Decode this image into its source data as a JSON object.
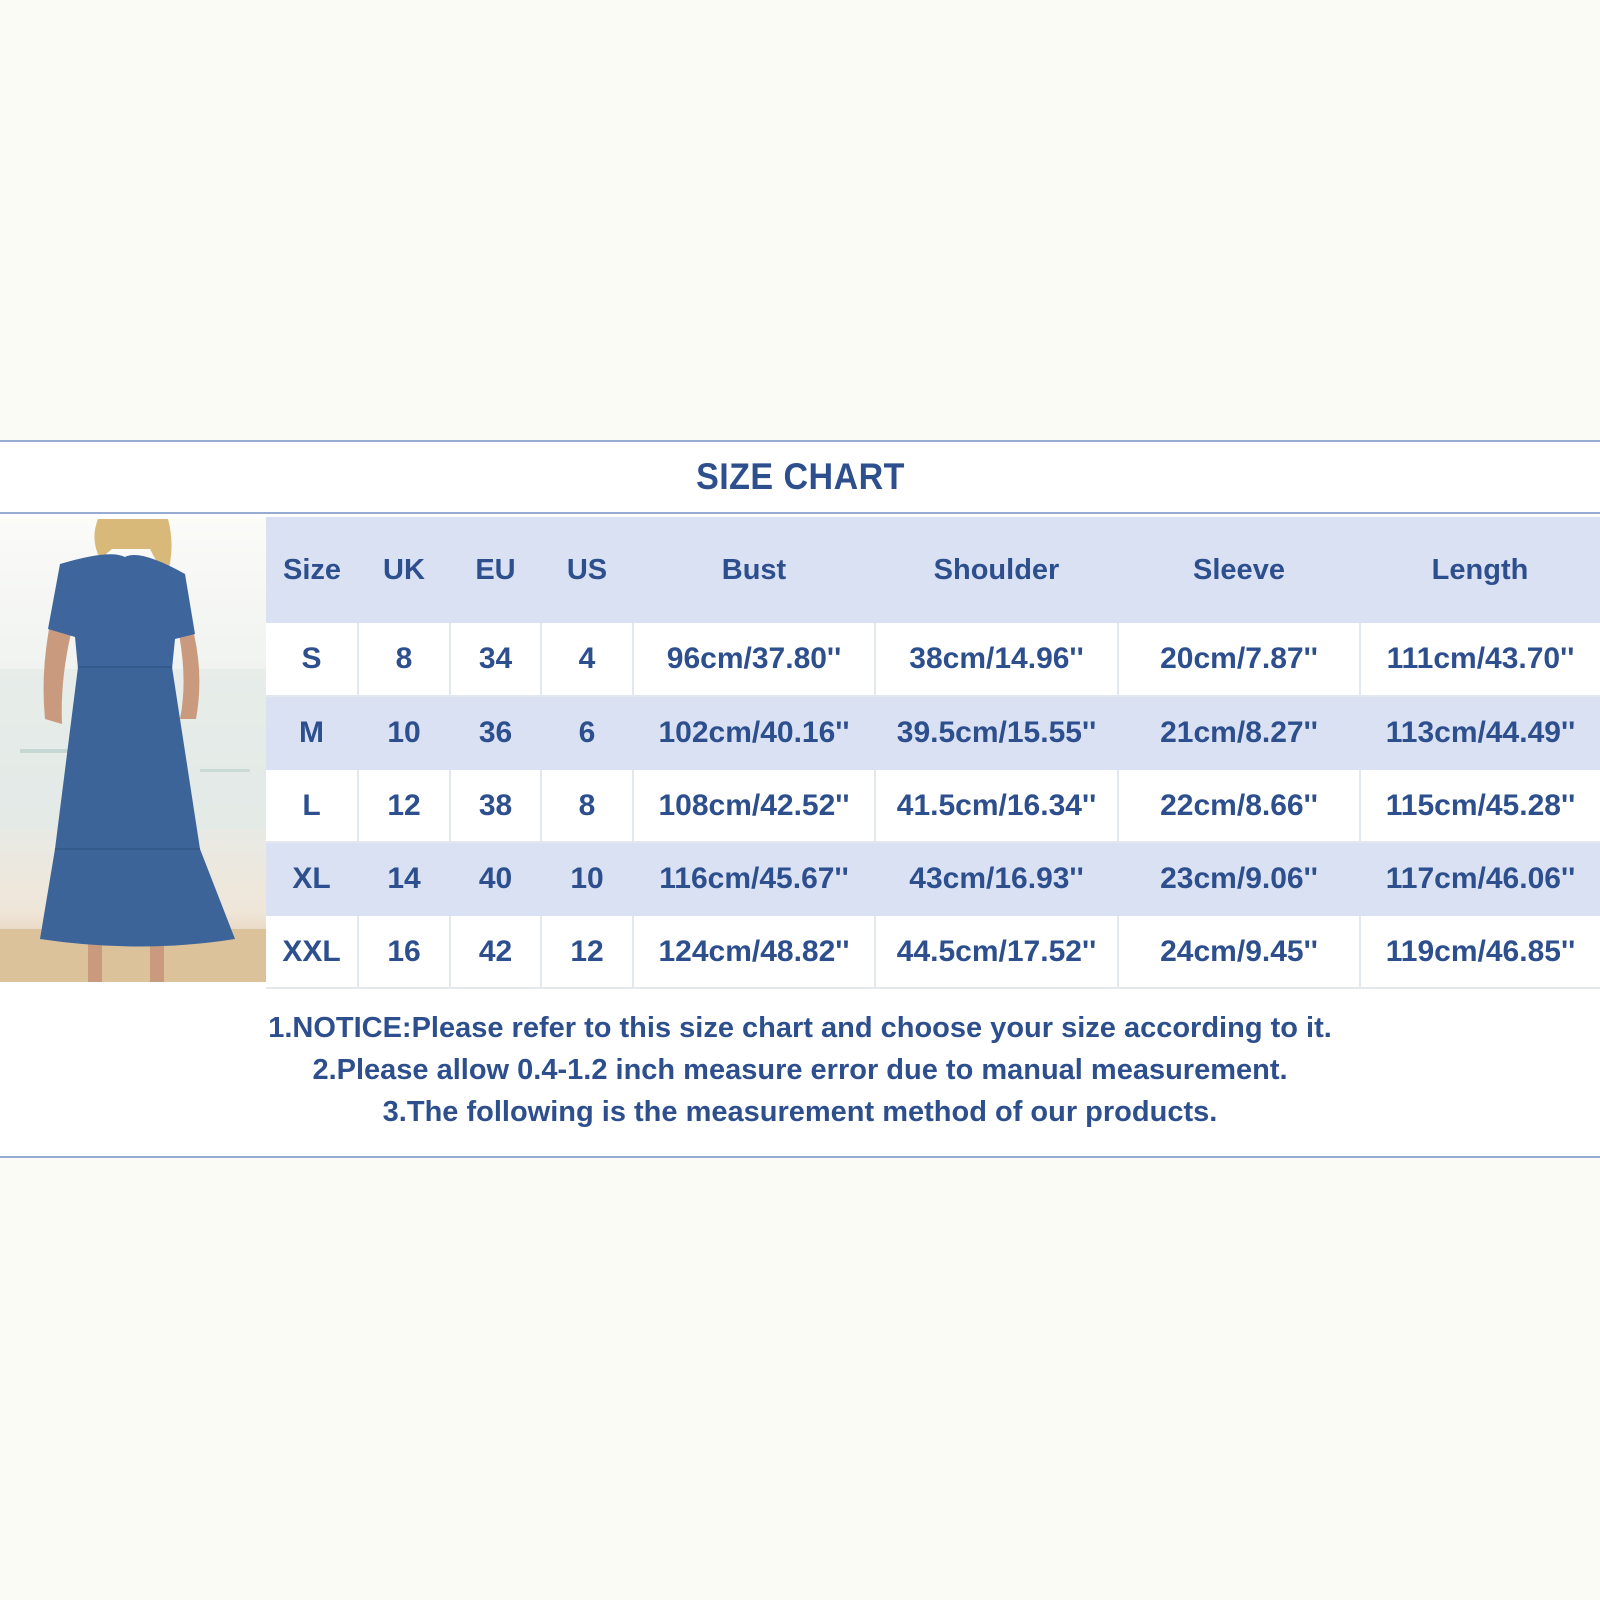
{
  "title": "SIZE CHART",
  "image": {
    "alt": "Woman wearing a blue short-sleeve tiered maxi dress with pockets on a beach"
  },
  "colors": {
    "text": "#2d4f8e",
    "header_bg": "#d9e1f3",
    "border": "#97abd3",
    "page_bg": "#fbfbf6"
  },
  "table": {
    "headers": [
      "Size",
      "UK",
      "EU",
      "US",
      "Bust",
      "Shoulder",
      "Sleeve",
      "Length"
    ],
    "rows": [
      [
        "S",
        "8",
        "34",
        "4",
        "96cm/37.80''",
        "38cm/14.96''",
        "20cm/7.87''",
        "111cm/43.70''"
      ],
      [
        "M",
        "10",
        "36",
        "6",
        "102cm/40.16''",
        "39.5cm/15.55''",
        "21cm/8.27''",
        "113cm/44.49''"
      ],
      [
        "L",
        "12",
        "38",
        "8",
        "108cm/42.52''",
        "41.5cm/16.34''",
        "22cm/8.66''",
        "115cm/45.28''"
      ],
      [
        "XL",
        "14",
        "40",
        "10",
        "116cm/45.67''",
        "43cm/16.93''",
        "23cm/9.06''",
        "117cm/46.06''"
      ],
      [
        "XXL",
        "16",
        "42",
        "12",
        "124cm/48.82''",
        "44.5cm/17.52''",
        "24cm/9.45''",
        "119cm/46.85''"
      ]
    ]
  },
  "notes": [
    "1.NOTICE:Please refer to this size chart and choose your size according to it.",
    "2.Please allow 0.4-1.2 inch measure error due to manual measurement.",
    "3.The following is the measurement method of our products."
  ]
}
